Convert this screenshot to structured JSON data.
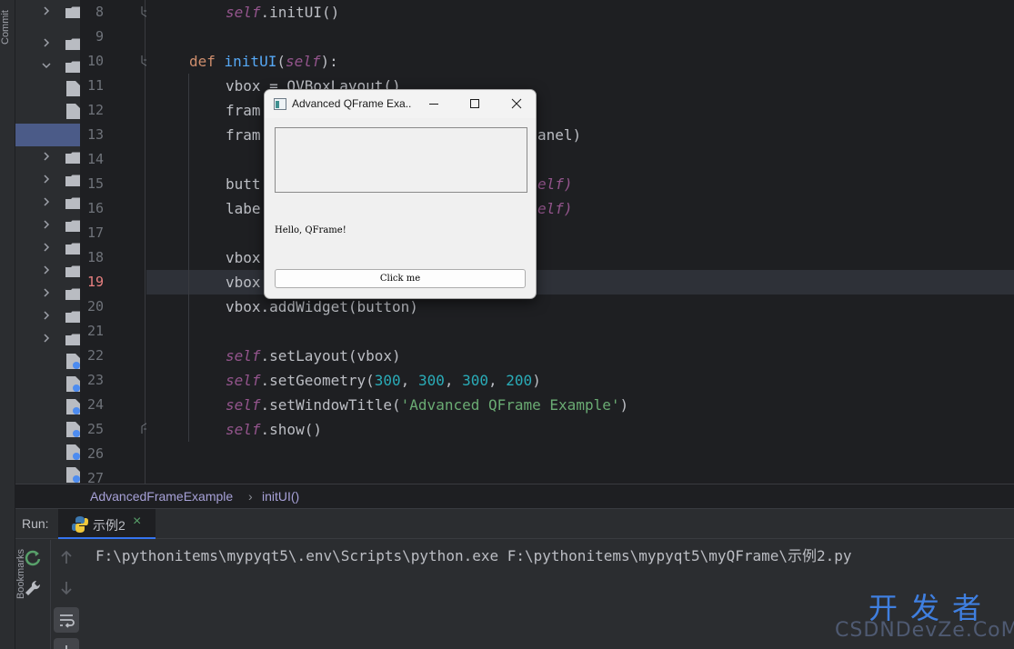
{
  "sidebar": {
    "commit_label": "Commit",
    "bookmarks_label": "Bookmarks"
  },
  "editor": {
    "lines": [
      {
        "n": "8"
      },
      {
        "n": "9"
      },
      {
        "n": "10"
      },
      {
        "n": "11"
      },
      {
        "n": "12"
      },
      {
        "n": "13"
      },
      {
        "n": "14"
      },
      {
        "n": "15"
      },
      {
        "n": "16"
      },
      {
        "n": "17"
      },
      {
        "n": "18"
      },
      {
        "n": "19"
      },
      {
        "n": "20"
      },
      {
        "n": "21"
      },
      {
        "n": "22"
      },
      {
        "n": "23"
      },
      {
        "n": "24"
      },
      {
        "n": "25"
      },
      {
        "n": "26"
      },
      {
        "n": "27"
      }
    ],
    "current_line": "19",
    "code": {
      "l8_self": "self",
      "l8_rest": ".initUI()",
      "l10_def": "def ",
      "l10_fn": "initUI",
      "l10_p1": "(",
      "l10_self": "self",
      "l10_p2": "):",
      "l11": "vbox = QVBoxLayout()",
      "l12": "fram",
      "l13_a": "fram",
      "l13_b": "anel)",
      "l15_a": "butt",
      "l15_b": "elf)",
      "l16_a": "labe",
      "l16_b": "elf)",
      "l18": "vbox",
      "l19": "vbox",
      "l20_a": "vbox.addWidget(",
      "l20_b": "button",
      "l20_c": ")",
      "l22_self": "self",
      "l22_rest": ".setLayout(vbox)",
      "l23_self": "self",
      "l23_a": ".setGeometry(",
      "l23_n1": "300",
      "l23_c1": ", ",
      "l23_n2": "300",
      "l23_c2": ", ",
      "l23_n3": "300",
      "l23_c3": ", ",
      "l23_n4": "200",
      "l23_e": ")",
      "l24_self": "self",
      "l24_a": ".setWindowTitle(",
      "l24_str": "'Advanced QFrame Example'",
      "l24_e": ")",
      "l25_self": "self",
      "l25_rest": ".show()"
    }
  },
  "breadcrumb": {
    "class_name": "AdvancedFrameExample",
    "separator": "›",
    "method": "initUI()"
  },
  "run": {
    "label": "Run:",
    "tab_name": "示例2",
    "tab_close": "×",
    "console_line": "F:\\pythonitems\\mypyqt5\\.env\\Scripts\\python.exe F:\\pythonitems\\mypyqt5\\myQFrame\\示例2.py"
  },
  "qt_window": {
    "title": "Advanced QFrame Exa...",
    "label_text": "Hello, QFrame!",
    "button_text": "Click me"
  },
  "watermark": {
    "top": "开发者",
    "bottom": "CSDNDevZe.CoM"
  },
  "colors": {
    "editor_bg": "#1e1f22",
    "panel_bg": "#2b2d30",
    "selection": "#4b5b88",
    "keyword": "#cf8e6d",
    "self": "#94558d",
    "function": "#56a8f5",
    "number": "#2aacb8",
    "string": "#6aab73",
    "current_line_number": "#e88080",
    "run_green": "#58a06a",
    "stop_red": "#e05555"
  }
}
